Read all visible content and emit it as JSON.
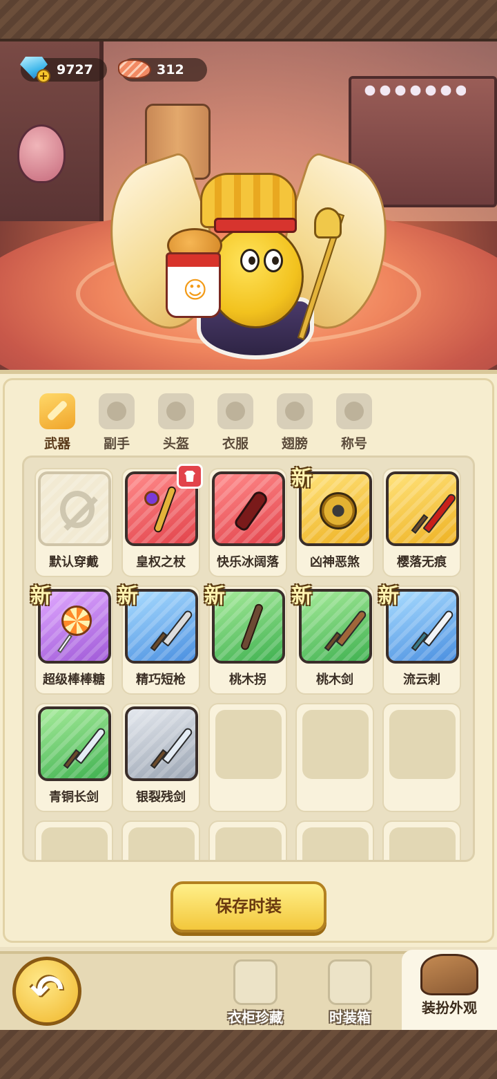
{
  "currency": {
    "gems": "9727",
    "meat": "312"
  },
  "tabs": [
    {
      "label": "武器",
      "icon": "sword-icon",
      "active": true
    },
    {
      "label": "副手",
      "icon": "offhand-icon",
      "active": false
    },
    {
      "label": "头盔",
      "icon": "helmet-icon",
      "active": false
    },
    {
      "label": "衣服",
      "icon": "armor-icon",
      "active": false
    },
    {
      "label": "翅膀",
      "icon": "wing-icon",
      "active": false
    },
    {
      "label": "称号",
      "icon": "title-icon",
      "active": false
    }
  ],
  "items": [
    {
      "name": "默认穿戴",
      "rarity": "default",
      "art": "ban",
      "new": false
    },
    {
      "name": "皇权之杖",
      "rarity": "red",
      "art": "scepter",
      "new": false,
      "equipped": true
    },
    {
      "name": "快乐冰阔落",
      "rarity": "red",
      "art": "bottle",
      "new": false
    },
    {
      "name": "凶神恶煞",
      "rarity": "gold",
      "art": "mace",
      "new": true
    },
    {
      "name": "樱落无痕",
      "rarity": "gold",
      "art": "katana",
      "new": false
    },
    {
      "name": "超级棒棒糖",
      "rarity": "purple",
      "art": "lollipop",
      "new": true
    },
    {
      "name": "精巧短枪",
      "rarity": "blue",
      "art": "spear",
      "new": true
    },
    {
      "name": "桃木拐",
      "rarity": "green",
      "art": "staff",
      "new": true
    },
    {
      "name": "桃木剑",
      "rarity": "green",
      "art": "wood-sword",
      "new": true
    },
    {
      "name": "流云刺",
      "rarity": "blue",
      "art": "dagger",
      "new": true
    },
    {
      "name": "青铜长剑",
      "rarity": "green",
      "art": "sword",
      "new": false
    },
    {
      "name": "银裂残剑",
      "rarity": "silver",
      "art": "sword",
      "new": false
    }
  ],
  "new_badge": "新",
  "save_button": "保存时装",
  "nav": {
    "wardrobe": "衣柜珍藏",
    "fashion_box": "时装箱",
    "appearance": "装扮外观"
  },
  "colors": {
    "red": "#e2434b",
    "gold": "#eeb223",
    "purple": "#a05ad8",
    "blue": "#4a8fe0",
    "green": "#3fb150",
    "silver": "#9aa4b2"
  }
}
